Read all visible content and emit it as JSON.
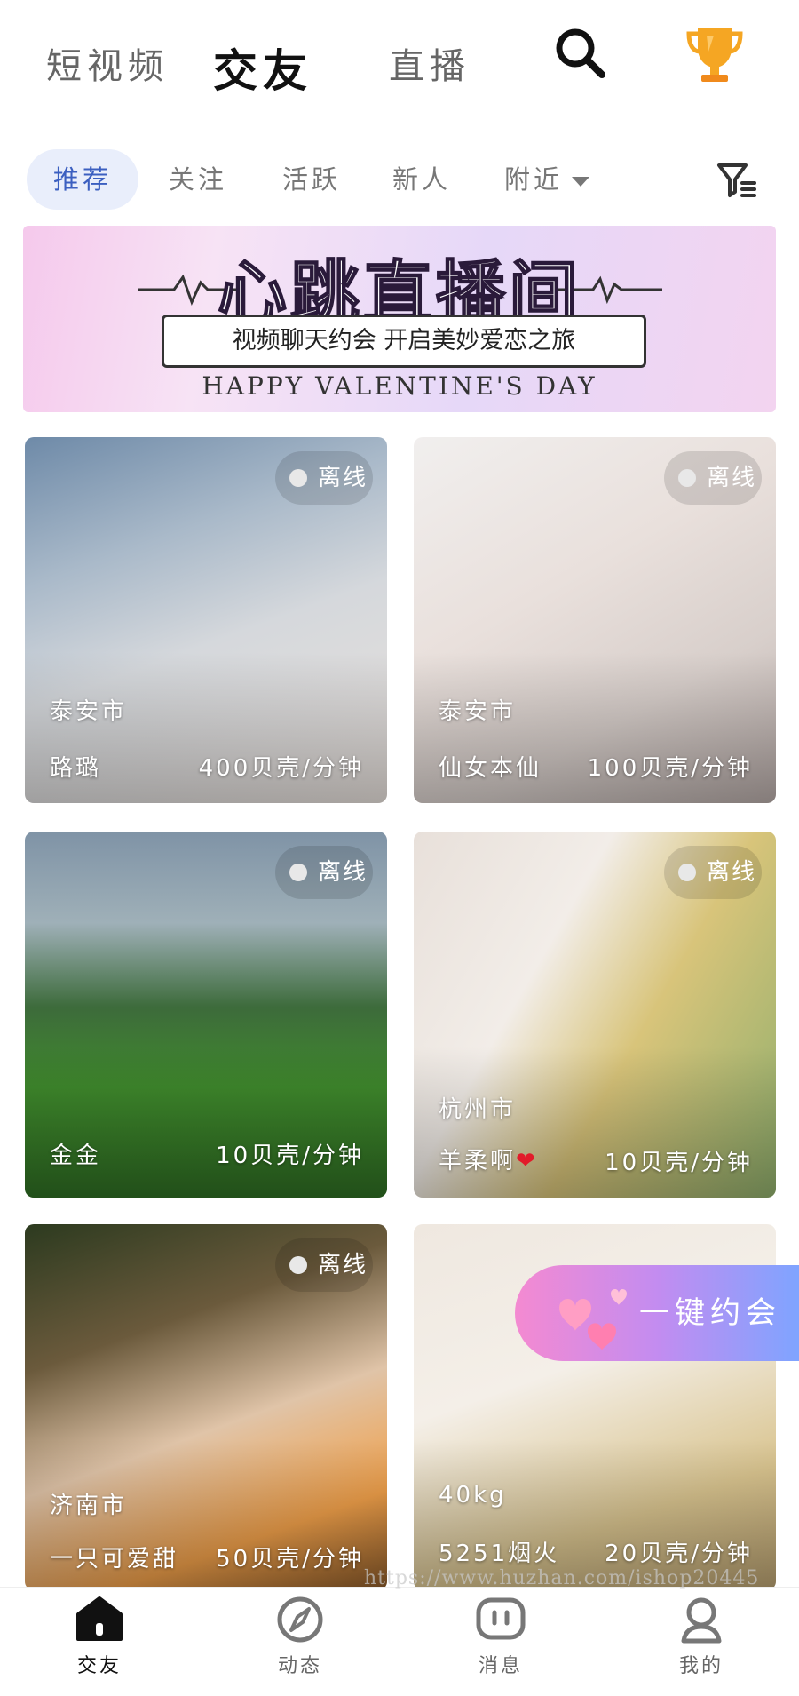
{
  "top_tabs": [
    "短视频",
    "交友",
    "直播"
  ],
  "filters": {
    "items": [
      "推荐",
      "关注",
      "活跃",
      "新人",
      "附近"
    ]
  },
  "banner": {
    "title": "心跳直播间",
    "subtitle": "视频聊天约会 开启美妙爱恋之旅",
    "english": "HAPPY VALENTINE'S DAY"
  },
  "cards": [
    {
      "status": "离线",
      "location": "泰安市",
      "name": "路璐",
      "price": "400贝壳/分钟"
    },
    {
      "status": "离线",
      "location": "泰安市",
      "name": "仙女本仙",
      "price": "100贝壳/分钟"
    },
    {
      "status": "离线",
      "location": "",
      "name": "金金",
      "price": "10贝壳/分钟"
    },
    {
      "status": "离线",
      "location": "杭州市",
      "name": "羊柔啊",
      "price": "10贝壳/分钟"
    },
    {
      "status": "离线",
      "location": "济南市",
      "name": "一只可爱甜",
      "price": "50贝壳/分钟"
    },
    {
      "status": "",
      "location": "40kg",
      "name": "5251烟火",
      "price": "20贝壳/分钟"
    }
  ],
  "floating_button": "一键约会",
  "watermark": "https://www.huzhan.com/ishop20445",
  "bottom_nav": [
    "交友",
    "动态",
    "消息",
    "我的"
  ],
  "colors": {
    "active_filter_bg": "#e9eefb",
    "active_filter_text": "#3b5fc0",
    "trophy": "#f5a623"
  }
}
